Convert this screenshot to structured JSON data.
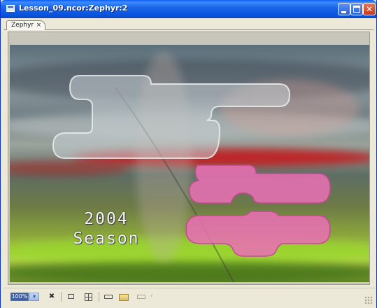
{
  "window": {
    "title": "Lesson_09.ncor:Zephyr:2",
    "buttons": {
      "minimize": "",
      "maximize": "",
      "close": "✕"
    }
  },
  "tabs": [
    {
      "label": "Zephyr",
      "close": "×"
    }
  ],
  "canvas": {
    "season_text_line1": "2004",
    "season_text_line2": "Season",
    "shapes": {
      "gray_pill_colors": {
        "fill": "#c8cfd4",
        "stroke": "#eef2f4"
      },
      "pink_pill_colors": {
        "fill": "#e76fb2",
        "stroke": "#c24b90"
      }
    }
  },
  "statusbar": {
    "zoom_value": "100%",
    "zoom_dropdown": "▾",
    "icons": [
      "close-x-icon",
      "frame-icon",
      "grid-icon",
      "widescreen-icon",
      "folder-icon",
      "disabled-frame-icon"
    ],
    "arrow": "‹"
  }
}
